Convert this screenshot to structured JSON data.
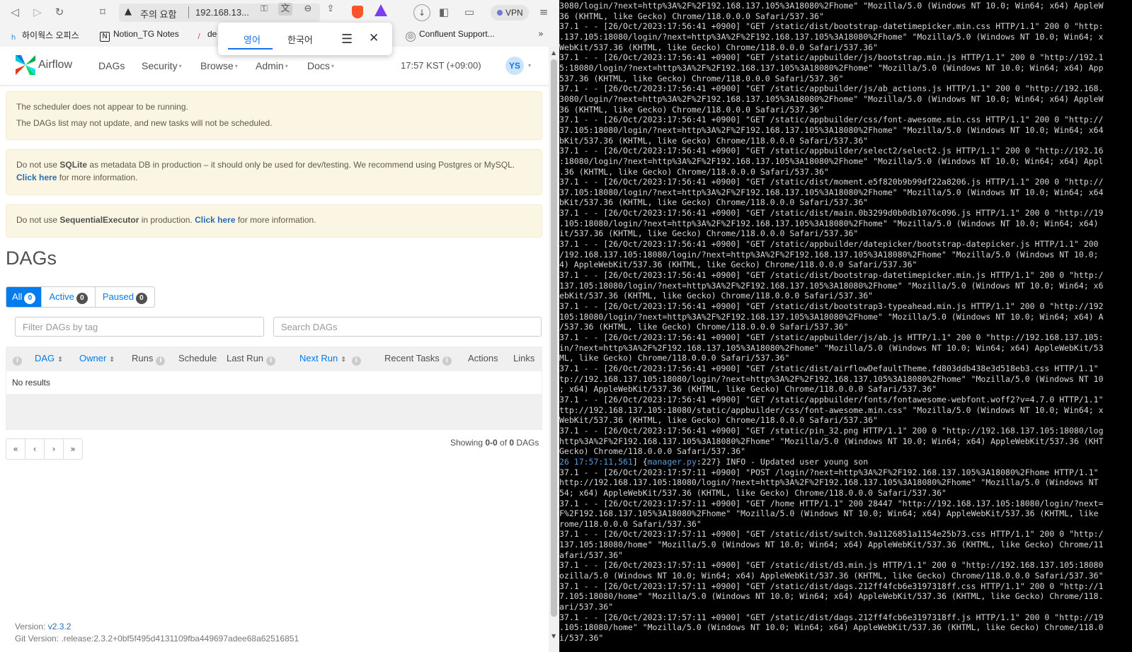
{
  "browser": {
    "url_warning": "주의 요함",
    "url_text": "192.168.13...",
    "vpn_label": "VPN",
    "bookmarks": [
      {
        "label": "하이웍스 오피스",
        "icon": "hiworks-icon"
      },
      {
        "label": "Notion_TG Notes",
        "icon": "notion-icon"
      },
      {
        "label": "de",
        "icon": "pencil-icon"
      },
      {
        "label": "Confluent Support...",
        "icon": "confluent-icon"
      }
    ],
    "translate_popup": {
      "tab_active": "영어",
      "tab_other": "한국어"
    }
  },
  "airflow": {
    "brand": "Airflow",
    "nav": [
      "DAGs",
      "Security",
      "Browse",
      "Admin",
      "Docs"
    ],
    "clock": "17:57 KST (+09:00)",
    "user_initials": "YS",
    "alerts": {
      "scheduler_line1": "The scheduler does not appear to be running.",
      "scheduler_line2": "The DAGs list may not update, and new tasks will not be scheduled.",
      "sqlite_pre": "Do not use ",
      "sqlite_bold": "SQLite",
      "sqlite_post": " as metadata DB in production – it should only be used for dev/testing. We recommend using Postgres or MySQL.",
      "sqlite_link": "Click here",
      "sqlite_tail": " for more information.",
      "executor_pre": "Do not use ",
      "executor_bold": "SequentialExecutor",
      "executor_mid": " in production. ",
      "executor_link": "Click here",
      "executor_tail": " for more information."
    },
    "page_title": "DAGs",
    "status_tabs": [
      {
        "label": "All",
        "count": "0"
      },
      {
        "label": "Active",
        "count": "0"
      },
      {
        "label": "Paused",
        "count": "0"
      }
    ],
    "filter_tag_placeholder": "Filter DAGs by tag",
    "search_placeholder": "Search DAGs",
    "columns": {
      "dag": "DAG",
      "owner": "Owner",
      "runs": "Runs",
      "schedule": "Schedule",
      "last_run": "Last Run",
      "next_run": "Next Run",
      "recent_tasks": "Recent Tasks",
      "actions": "Actions",
      "links": "Links"
    },
    "no_results": "No results",
    "pagination": [
      "«",
      "‹",
      "›",
      "»"
    ],
    "showing": {
      "pre": "Showing ",
      "range": "0-0",
      "mid": " of ",
      "total": "0",
      "post": " DAGs"
    },
    "version_label": "Version: ",
    "version": "v2.3.2",
    "git_version": "Git Version: .release:2.3.2+0bf5f495d4131109fba449697adee68a62516851"
  },
  "terminal": {
    "lines": [
      "3080/login/?next=http%3A%2F%2F192.168.137.105%3A18080%2Fhome\" \"Mozilla/5.0 (Windows NT 10.0; Win64; x64) AppleW",
      "36 (KHTML, like Gecko) Chrome/118.0.0.0 Safari/537.36\"",
      "37.1 - - [26/Oct/2023:17:56:41 +0900] \"GET /static/dist/bootstrap-datetimepicker.min.css HTTP/1.1\" 200 0 \"http:",
      ".137.105:18080/login/?next=http%3A%2F%2F192.168.137.105%3A18080%2Fhome\" \"Mozilla/5.0 (Windows NT 10.0; Win64; x",
      "WebKit/537.36 (KHTML, like Gecko) Chrome/118.0.0.0 Safari/537.36\"",
      "37.1 - - [26/Oct/2023:17:56:41 +0900] \"GET /static/appbuilder/js/bootstrap.min.js HTTP/1.1\" 200 0 \"http://192.1",
      "5:18080/login/?next=http%3A%2F%2F192.168.137.105%3A18080%2Fhome\" \"Mozilla/5.0 (Windows NT 10.0; Win64; x64) App",
      "537.36 (KHTML, like Gecko) Chrome/118.0.0.0 Safari/537.36\"",
      "37.1 - - [26/Oct/2023:17:56:41 +0900] \"GET /static/appbuilder/js/ab_actions.js HTTP/1.1\" 200 0 \"http://192.168.",
      "3080/login/?next=http%3A%2F%2F192.168.137.105%3A18080%2Fhome\" \"Mozilla/5.0 (Windows NT 10.0; Win64; x64) AppleW",
      "36 (KHTML, like Gecko) Chrome/118.0.0.0 Safari/537.36\"",
      "37.1 - - [26/Oct/2023:17:56:41 +0900] \"GET /static/appbuilder/css/font-awesome.min.css HTTP/1.1\" 200 0 \"http://",
      "37.105:18080/login/?next=http%3A%2F%2F192.168.137.105%3A18080%2Fhome\" \"Mozilla/5.0 (Windows NT 10.0; Win64; x64",
      "bKit/537.36 (KHTML, like Gecko) Chrome/118.0.0.0 Safari/537.36\"",
      "37.1 - - [26/Oct/2023:17:56:41 +0900] \"GET /static/appbuilder/select2/select2.js HTTP/1.1\" 200 0 \"http://192.16",
      ":18080/login/?next=http%3A%2F%2F192.168.137.105%3A18080%2Fhome\" \"Mozilla/5.0 (Windows NT 10.0; Win64; x64) Appl",
      ".36 (KHTML, like Gecko) Chrome/118.0.0.0 Safari/537.36\"",
      "37.1 - - [26/Oct/2023:17:56:41 +0900] \"GET /static/dist/moment.e5f820b9b99df22a8206.js HTTP/1.1\" 200 0 \"http://",
      "37.105:18080/login/?next=http%3A%2F%2F192.168.137.105%3A18080%2Fhome\" \"Mozilla/5.0 (Windows NT 10.0; Win64; x64",
      "bKit/537.36 (KHTML, like Gecko) Chrome/118.0.0.0 Safari/537.36\"",
      "37.1 - - [26/Oct/2023:17:56:41 +0900] \"GET /static/dist/main.0b3299d0b0db1076c096.js HTTP/1.1\" 200 0 \"http://19",
      ".105:18080/login/?next=http%3A%2F%2F192.168.137.105%3A18080%2Fhome\" \"Mozilla/5.0 (Windows NT 10.0; Win64; x64)",
      "it/537.36 (KHTML, like Gecko) Chrome/118.0.0.0 Safari/537.36\"",
      "37.1 - - [26/Oct/2023:17:56:41 +0900] \"GET /static/appbuilder/datepicker/bootstrap-datepicker.js HTTP/1.1\" 200",
      "/192.168.137.105:18080/login/?next=http%3A%2F%2F192.168.137.105%3A18080%2Fhome\" \"Mozilla/5.0 (Windows NT 10.0;",
      "4) AppleWebKit/537.36 (KHTML, like Gecko) Chrome/118.0.0.0 Safari/537.36\"",
      "37.1 - - [26/Oct/2023:17:56:41 +0900] \"GET /static/dist/bootstrap-datetimepicker.min.js HTTP/1.1\" 200 0 \"http:/",
      "137.105:18080/login/?next=http%3A%2F%2F192.168.137.105%3A18080%2Fhome\" \"Mozilla/5.0 (Windows NT 10.0; Win64; x6",
      "ebKit/537.36 (KHTML, like Gecko) Chrome/118.0.0.0 Safari/537.36\"",
      "37.1 - - [26/Oct/2023:17:56:41 +0900] \"GET /static/dist/bootstrap3-typeahead.min.js HTTP/1.1\" 200 0 \"http://192",
      "105:18080/login/?next=http%3A%2F%2F192.168.137.105%3A18080%2Fhome\" \"Mozilla/5.0 (Windows NT 10.0; Win64; x64) A",
      "/537.36 (KHTML, like Gecko) Chrome/118.0.0.0 Safari/537.36\"",
      "37.1 - - [26/Oct/2023:17:56:41 +0900] \"GET /static/appbuilder/js/ab.js HTTP/1.1\" 200 0 \"http://192.168.137.105:",
      "in/?next=http%3A%2F%2F192.168.137.105%3A18080%2Fhome\" \"Mozilla/5.0 (Windows NT 10.0; Win64; x64) AppleWebKit/53",
      "ML, like Gecko) Chrome/118.0.0.0 Safari/537.36\"",
      "37.1 - - [26/Oct/2023:17:56:41 +0900] \"GET /static/dist/airflowDefaultTheme.fd803ddb438e3d518eb3.css HTTP/1.1\"",
      "tp://192.168.137.105:18080/login/?next=http%3A%2F%2F192.168.137.105%3A18080%2Fhome\" \"Mozilla/5.0 (Windows NT 10",
      "; x64) AppleWebKit/537.36 (KHTML, like Gecko) Chrome/118.0.0.0 Safari/537.36\"",
      "37.1 - - [26/Oct/2023:17:56:41 +0900] \"GET /static/appbuilder/fonts/fontawesome-webfont.woff2?v=4.7.0 HTTP/1.1\"",
      "ttp://192.168.137.105:18080/static/appbuilder/css/font-awesome.min.css\" \"Mozilla/5.0 (Windows NT 10.0; Win64; x",
      "WebKit/537.36 (KHTML, like Gecko) Chrome/118.0.0.0 Safari/537.36\"",
      "37.1 - - [26/Oct/2023:17:56:41 +0900] \"GET /static/pin_32.png HTTP/1.1\" 200 0 \"http://192.168.137.105:18080/log",
      "http%3A%2F%2F192.168.137.105%3A18080%2Fhome\" \"Mozilla/5.0 (Windows NT 10.0; Win64; x64) AppleWebKit/537.36 (KHT",
      "Gecko) Chrome/118.0.0.0 Safari/537.36\"",
      "26 17:57:11,561] {manager.py:227} INFO - Updated user young son",
      "37.1 - - [26/Oct/2023:17:57:11 +0900] \"POST /login/?next=http%3A%2F%2F192.168.137.105%3A18080%2Fhome HTTP/1.1\"",
      "http://192.168.137.105:18080/login/?next=http%3A%2F%2F192.168.137.105%3A18080%2Fhome\" \"Mozilla/5.0 (Windows NT",
      "54; x64) AppleWebKit/537.36 (KHTML, like Gecko) Chrome/118.0.0.0 Safari/537.36\"",
      "37.1 - - [26/Oct/2023:17:57:11 +0900] \"GET /home HTTP/1.1\" 200 28447 \"http://192.168.137.105:18080/login/?next=",
      "F%2F192.168.137.105%3A18080%2Fhome\" \"Mozilla/5.0 (Windows NT 10.0; Win64; x64) AppleWebKit/537.36 (KHTML, like",
      "rome/118.0.0.0 Safari/537.36\"",
      "37.1 - - [26/Oct/2023:17:57:11 +0900] \"GET /static/dist/switch.9a1126851a1154e25b73.css HTTP/1.1\" 200 0 \"http:/",
      "137.105:18080/home\" \"Mozilla/5.0 (Windows NT 10.0; Win64; x64) AppleWebKit/537.36 (KHTML, like Gecko) Chrome/11",
      "afari/537.36\"",
      "37.1 - - [26/Oct/2023:17:57:11 +0900] \"GET /static/dist/d3.min.js HTTP/1.1\" 200 0 \"http://192.168.137.105:18080",
      "ozilla/5.0 (Windows NT 10.0; Win64; x64) AppleWebKit/537.36 (KHTML, like Gecko) Chrome/118.0.0.0 Safari/537.36\"",
      "37.1 - - [26/Oct/2023:17:57:11 +0900] \"GET /static/dist/dags.212ff4fcb6e3197318ff.css HTTP/1.1\" 200 0 \"http://1",
      "7.105:18080/home\" \"Mozilla/5.0 (Windows NT 10.0; Win64; x64) AppleWebKit/537.36 (KHTML, like Gecko) Chrome/118.",
      "ari/537.36\"",
      "37.1 - - [26/Oct/2023:17:57:11 +0900] \"GET /static/dist/dags.212ff4fcb6e3197318ff.js HTTP/1.1\" 200 0 \"http://19",
      ".105:18080/home\" \"Mozilla/5.0 (Windows NT 10.0; Win64; x64) AppleWebKit/537.36 (KHTML, like Gecko) Chrome/118.0",
      "i/537.36\""
    ],
    "highlight_line_index": 44,
    "highlight_parts": {
      "pre": "26 17:57:11,561",
      "mid": "] {",
      "file": "manager.py",
      "lineno": ":227",
      "post": "} INFO - Updated user young son"
    }
  }
}
